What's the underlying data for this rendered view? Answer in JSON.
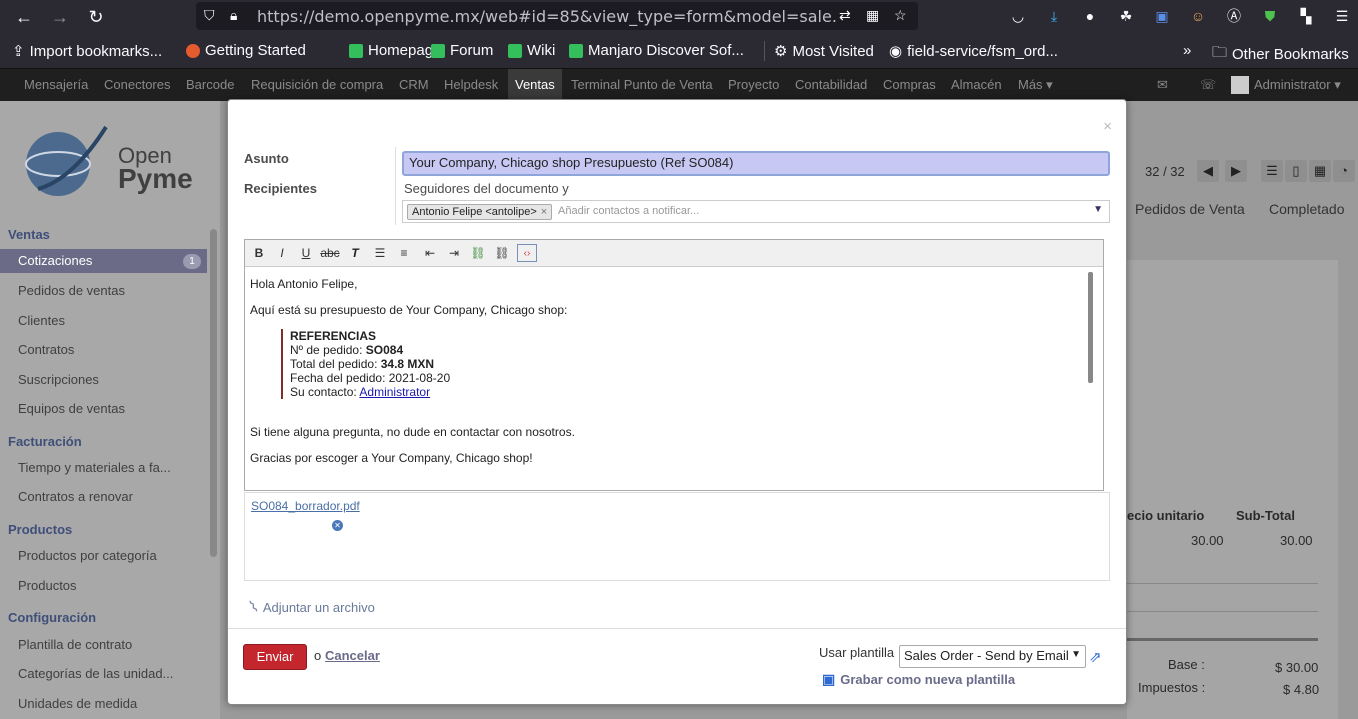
{
  "browser": {
    "url": "https://demo.openpyme.mx/web#id=85&view_type=form&model=sale.order&m",
    "bookmarks": [
      "Import bookmarks...",
      "Getting Started",
      "Homepage",
      "Forum",
      "Wiki",
      "Manjaro Discover Sof...",
      "Most Visited",
      "field-service/fsm_ord...",
      "Other Bookmarks"
    ]
  },
  "topnav": {
    "items": [
      "Mensajería",
      "Conectores",
      "Barcode",
      "Requisición de compra",
      "CRM",
      "Helpdesk",
      "Ventas",
      "Terminal Punto de Venta",
      "Proyecto",
      "Contabilidad",
      "Compras",
      "Almacén",
      "Más"
    ],
    "user": "Administrator"
  },
  "sidebar": {
    "logo_top": "Open",
    "logo_bottom": "Pyme",
    "sections": [
      {
        "title": "Ventas",
        "items": [
          "Cotizaciones",
          "Pedidos de ventas",
          "Clientes",
          "Contratos",
          "Suscripciones",
          "Equipos de ventas"
        ]
      },
      {
        "title": "Facturación",
        "items": [
          "Tiempo y materiales a fa...",
          "Contratos a renovar"
        ]
      },
      {
        "title": "Productos",
        "items": [
          "Productos por categoría",
          "Productos"
        ]
      },
      {
        "title": "Configuración",
        "items": [
          "Plantilla de contrato",
          "Categorías de las unidad...",
          "Unidades de medida"
        ]
      }
    ],
    "badge": "1"
  },
  "background": {
    "pager": "32 / 32",
    "tabs": [
      "Pedidos de Venta",
      "Completado"
    ],
    "col_unit_price": "ecio unitario",
    "col_subtotal": "Sub-Total",
    "unit_price": "30.00",
    "subtotal": "30.00",
    "base_label": "Base :",
    "base_value": "$ 30.00",
    "tax_label": "Impuestos :",
    "tax_value": "$ 4.80"
  },
  "modal": {
    "close": "×",
    "subject_label": "Asunto",
    "subject_value": "Your Company, Chicago shop Presupuesto (Ref SO084)",
    "recipients_label": "Recipientes",
    "followers_text": "Seguidores del documento y",
    "recipient_tag": "Antonio Felipe <antolipe>",
    "recipient_placeholder": "Añadir contactos a notificar...",
    "body": {
      "greeting": "Hola Antonio Felipe,",
      "intro": "Aquí está su presupuesto de Your Company, Chicago shop:",
      "ref_title": "REFERENCIAS",
      "order_label": "Nº de pedido: ",
      "order_value": "SO084",
      "total_label": "Total del pedido: ",
      "total_value": "34.8 MXN",
      "date_line": "Fecha del pedido: 2021-08-20",
      "contact_label": "Su contacto: ",
      "contact_value": "Administrator",
      "questions": "Si tiene alguna pregunta, no dude en contactar con nosotros.",
      "thanks": "Gracias por escoger a Your Company, Chicago shop!"
    },
    "attachment": "SO084_borrador.pdf",
    "add_attachment": "Adjuntar un archivo",
    "send_label": "Enviar",
    "or_text": "o",
    "cancel_label": "Cancelar",
    "template_label": "Usar plantilla",
    "template_value": "Sales Order - Send by Email",
    "save_template": "Grabar como nueva plantilla"
  }
}
